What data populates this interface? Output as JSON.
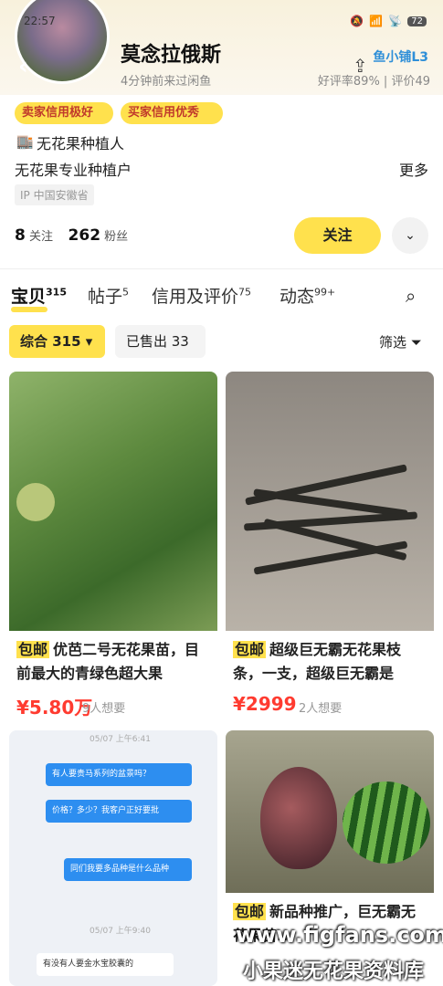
{
  "status": {
    "time": "22:57",
    "battery": "72"
  },
  "profile": {
    "name": "莫念拉俄斯",
    "last_seen": "4分钟前来过闲鱼",
    "shop_badge": "鱼小铺L3",
    "rating": "好评率89% | 评价49",
    "credit_tags": [
      "卖家信用极好",
      "买家信用优秀"
    ],
    "plant_title": "无花果种植人",
    "description": "无花果专业种植户",
    "more": "更多",
    "ip": "IP 中国安徽省",
    "following_count": "8",
    "following_label": "关注",
    "fans_count": "262",
    "fans_label": "粉丝",
    "follow_button": "关注"
  },
  "tabs": [
    {
      "label": "宝贝",
      "count": "315"
    },
    {
      "label": "帖子",
      "count": "5"
    },
    {
      "label": "信用及评价",
      "count": "75"
    },
    {
      "label": "动态",
      "count": "99+"
    }
  ],
  "filters": {
    "chip_all": "综合 315",
    "chip_sold": "已售出 33",
    "filter_label": "筛选"
  },
  "products": [
    {
      "badge": "包邮",
      "title": "优芭二号无花果苗，目前最大的青绿色超大果",
      "price": "¥5.80万",
      "wants": "9人想要"
    },
    {
      "badge": "包邮",
      "title": "超级巨无霸无花果枝条，一支，超级巨无霸是",
      "price": "¥2999",
      "wants": "2人想要"
    },
    {
      "badge": "",
      "title": "",
      "price": "",
      "wants": ""
    },
    {
      "badge": "包邮",
      "title": "新品种推广，巨无霸无花果苗...",
      "price": "",
      "wants": ""
    }
  ],
  "chat_preview": {
    "date1": "05/07 上午6:41",
    "msg1": "有人要贵马系列的盆景吗？",
    "msg2": "价格？多少？我客户正好要批",
    "msg3": "同们我要多品种是什么品种",
    "date2": "05/07 上午9:40",
    "msg4": "有没有人要金水宝胶囊的"
  },
  "watermark": {
    "line1": "www.figfans.com",
    "line2": "小果迷无花果资料库"
  }
}
